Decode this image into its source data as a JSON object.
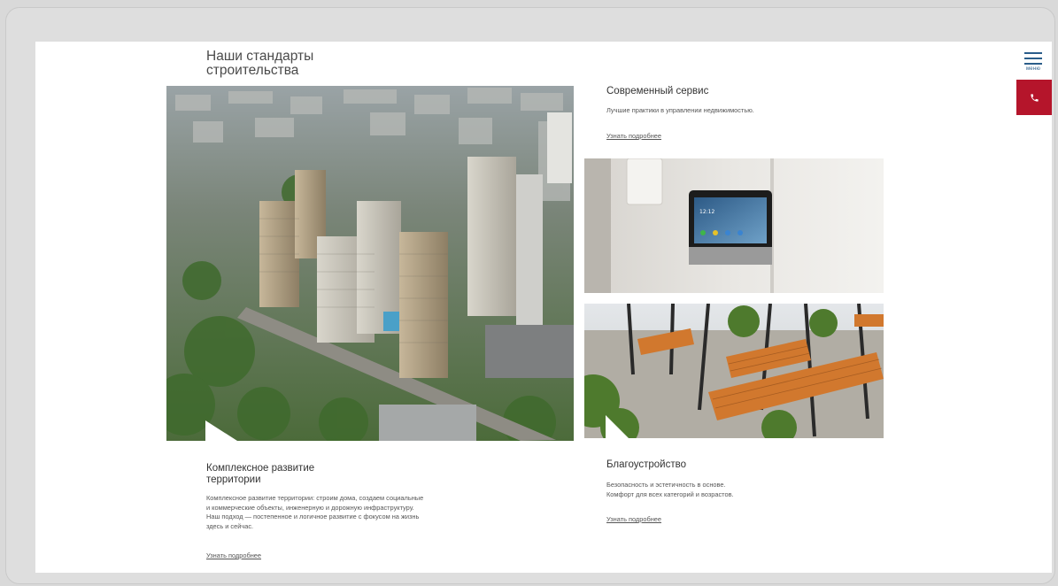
{
  "page": {
    "title": "Наши стандарты\nстроительства"
  },
  "header": {
    "menu_label": "меню"
  },
  "icons": {
    "menu": "hamburger-icon",
    "phone": "phone-icon"
  },
  "colors": {
    "accent": "#b5152b",
    "menu": "#2a5d8a"
  },
  "sections": {
    "service": {
      "title": "Современный сервис",
      "text": "Лучшие практики в управлении недвижимостью.",
      "link": "Узнать подробнее"
    },
    "territory": {
      "title": "Комплексное развитие\nтерритории",
      "text": "Комплексное развитие территории: строим дома, создаем  социальные\nи коммерческие объекты, инженерную и дорожную инфраструктуру.\nНаш подход — постепенное и логичное развитие с фокусом на жизнь\nздесь и сейчас.",
      "link": "Узнать подробнее"
    },
    "landscaping": {
      "title": "Благоустройство",
      "text": "Безопасность и эстетичность в основе.\nКомфорт для всех категорий и возрастов.",
      "link": "Узнать подробнее"
    }
  },
  "intercom": {
    "time": "12:12"
  }
}
